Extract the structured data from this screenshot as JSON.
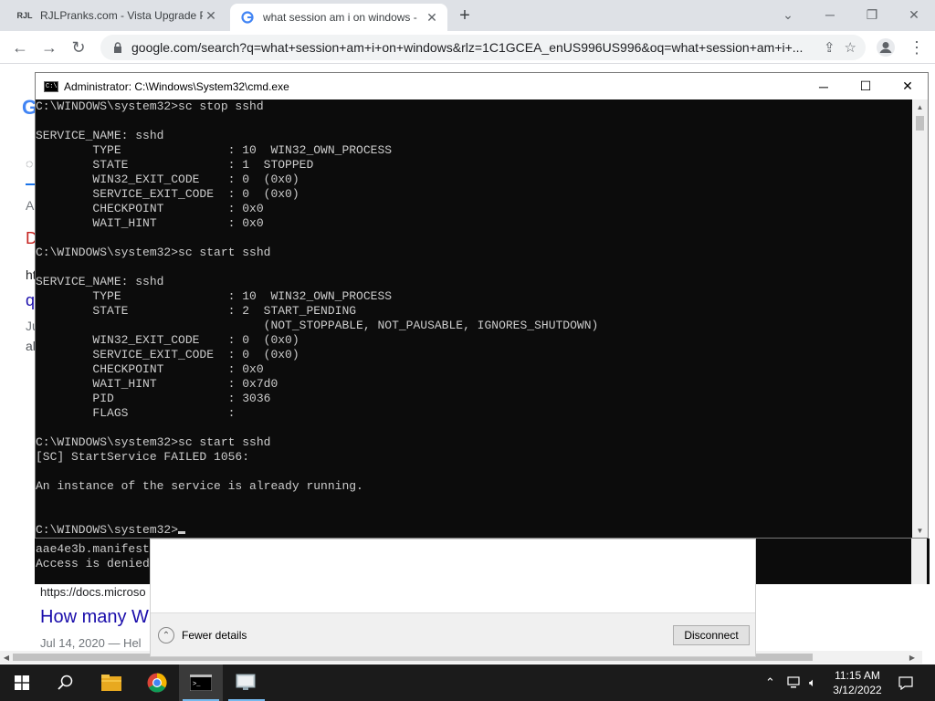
{
  "browser": {
    "tabs": [
      {
        "favicon": "RJL",
        "title": "RJLPranks.com - Vista Upgrade P"
      },
      {
        "favicon": "G",
        "title": "what session am i on windows - "
      }
    ],
    "url": "google.com/search?q=what+session+am+i+on+windows&rlz=1C1GCEA_enUS996US996&oq=what+session+am+i+..."
  },
  "google": {
    "logo": "G",
    "frag_a": "A",
    "frag_d": "D",
    "frag_ht": "ht",
    "frag_q": "q",
    "frag_ju": "Ju",
    "frag_al": "al",
    "result_url": "https://docs.microso",
    "result_title": "How many W",
    "result_date": "Jul 14, 2020 — Hel"
  },
  "bg_console": {
    "line1": "aae4e3b.manifest",
    "line2": "Access is denied"
  },
  "dialog": {
    "fewer_details": "Fewer details",
    "disconnect": "Disconnect"
  },
  "cmd": {
    "title": "Administrator: C:\\Windows\\System32\\cmd.exe",
    "lines": [
      "C:\\WINDOWS\\system32>sc stop sshd",
      "",
      "SERVICE_NAME: sshd",
      "        TYPE               : 10  WIN32_OWN_PROCESS",
      "        STATE              : 1  STOPPED",
      "        WIN32_EXIT_CODE    : 0  (0x0)",
      "        SERVICE_EXIT_CODE  : 0  (0x0)",
      "        CHECKPOINT         : 0x0",
      "        WAIT_HINT          : 0x0",
      "",
      "C:\\WINDOWS\\system32>sc start sshd",
      "",
      "SERVICE_NAME: sshd",
      "        TYPE               : 10  WIN32_OWN_PROCESS",
      "        STATE              : 2  START_PENDING",
      "                                (NOT_STOPPABLE, NOT_PAUSABLE, IGNORES_SHUTDOWN)",
      "        WIN32_EXIT_CODE    : 0  (0x0)",
      "        SERVICE_EXIT_CODE  : 0  (0x0)",
      "        CHECKPOINT         : 0x0",
      "        WAIT_HINT          : 0x7d0",
      "        PID                : 3036",
      "        FLAGS              :",
      "",
      "C:\\WINDOWS\\system32>sc start sshd",
      "[SC] StartService FAILED 1056:",
      "",
      "An instance of the service is already running.",
      "",
      "",
      "C:\\WINDOWS\\system32>"
    ]
  },
  "taskbar": {
    "time": "11:15 AM",
    "date": "3/12/2022"
  },
  "icons": {
    "tab_close": "close-icon",
    "back": "back-arrow-icon",
    "forward": "forward-arrow-icon",
    "reload": "reload-icon",
    "lock": "lock-icon",
    "share": "share-icon",
    "star": "star-icon",
    "profile": "profile-icon",
    "menu": "more-vert-icon"
  },
  "colors": {
    "console_bg": "#0c0c0c",
    "console_fg": "#cccccc",
    "link": "#1a0dab",
    "taskbar": "#1b1b1b"
  }
}
